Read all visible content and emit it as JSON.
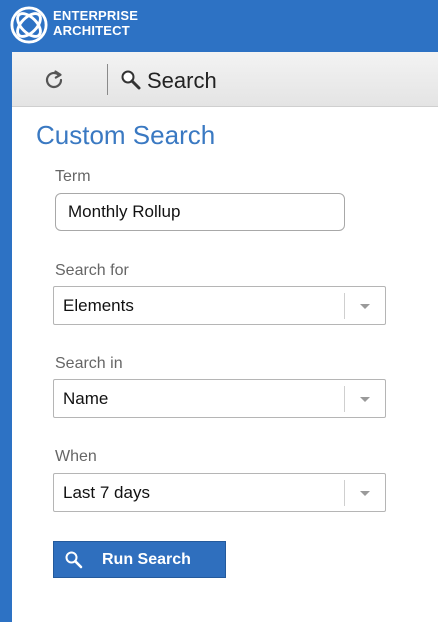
{
  "app": {
    "brand_line1": "ENTERPRISE",
    "brand_line2": "ARCHITECT"
  },
  "toolbar": {
    "search_label": "Search"
  },
  "panel": {
    "title": "Custom Search",
    "term": {
      "label": "Term",
      "value": "Monthly Rollup"
    },
    "search_for": {
      "label": "Search for",
      "value": "Elements"
    },
    "search_in": {
      "label": "Search in",
      "value": "Name"
    },
    "when": {
      "label": "When",
      "value": "Last 7 days"
    },
    "run_button": "Run Search"
  },
  "colors": {
    "brand_blue": "#2d72c4",
    "title_blue": "#3a79c2",
    "button_blue": "#2f6fbe"
  }
}
